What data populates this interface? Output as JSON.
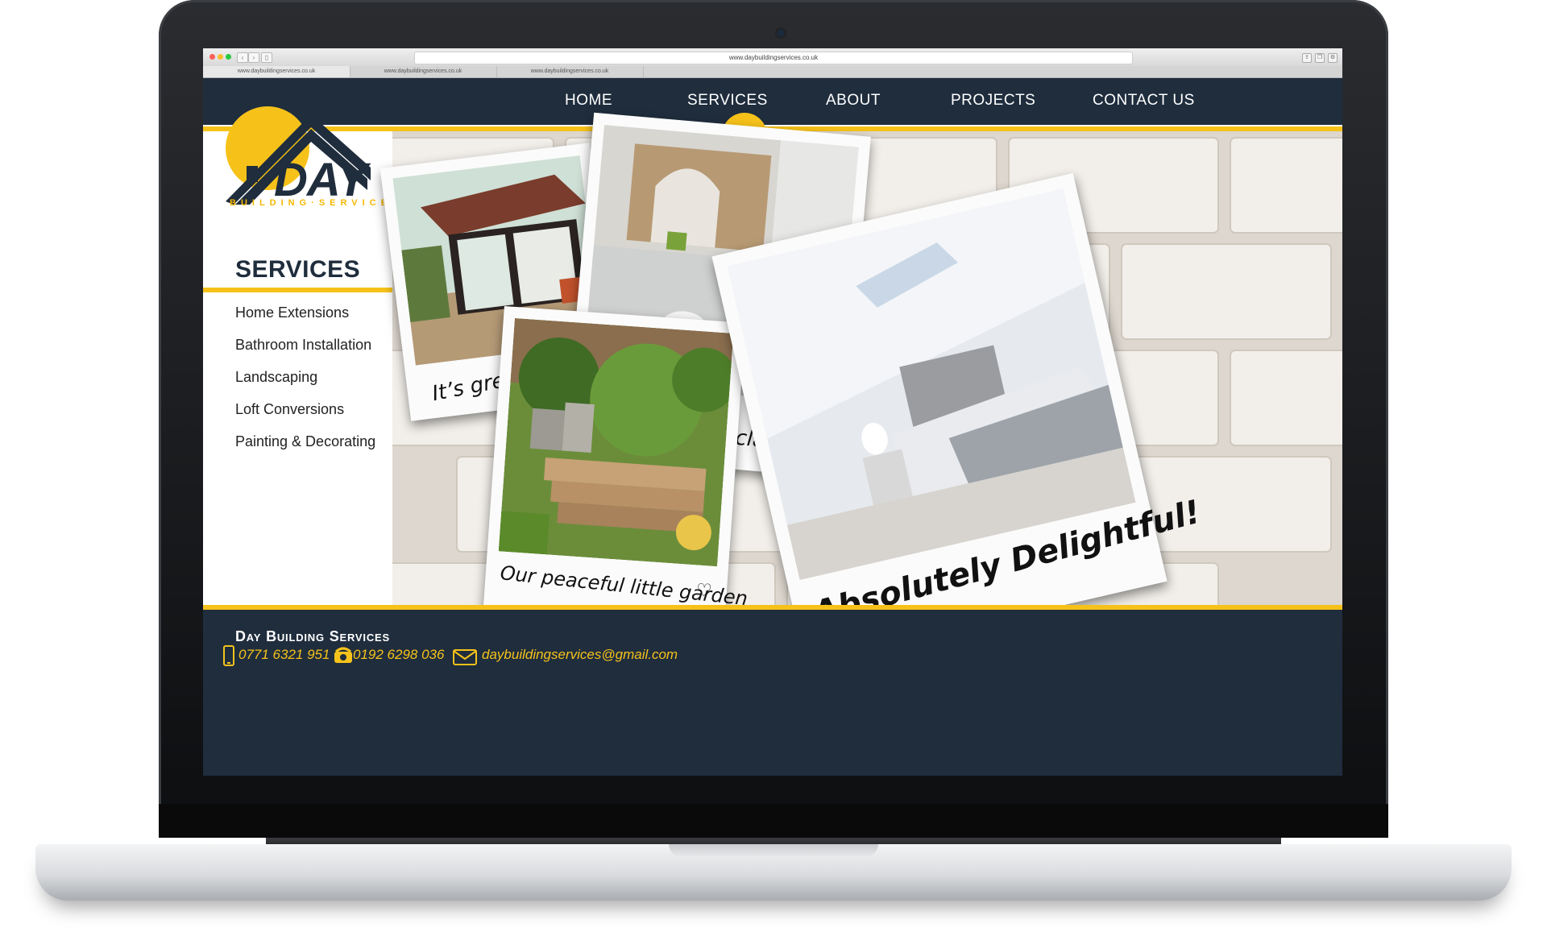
{
  "browser": {
    "url": "www.daybuildingservices.co.uk",
    "tabs": [
      "www.daybuildingservices.co.uk",
      "www.daybuildingservices.co.uk",
      "www.daybuildingservices.co.uk"
    ]
  },
  "logo": {
    "name": "DAY",
    "tagline": "BUILDING·SERVICES"
  },
  "nav": {
    "items": [
      "HOME",
      "SERVICES",
      "ABOUT",
      "PROJECTS",
      "CONTACT US"
    ],
    "active": "SERVICES"
  },
  "sidebar": {
    "title": "SERVICES",
    "items": [
      "Home Extensions",
      "Bathroom Installation",
      "Landscaping",
      "Loft Conversions",
      "Painting & Decorating"
    ]
  },
  "gallery": {
    "captions": {
      "extension": "It’s great in summer",
      "bathroom": "classic",
      "garden": "Our peaceful little garden",
      "loft": "Absolutely Delightful!"
    }
  },
  "footer": {
    "company": "Day Building Services",
    "mobile": "0771 6321 951",
    "phone": "0192 6298 036",
    "email": "daybuildingservices@gmail.com"
  },
  "colors": {
    "navy": "#1f2d3d",
    "accent": "#f6c21a"
  }
}
